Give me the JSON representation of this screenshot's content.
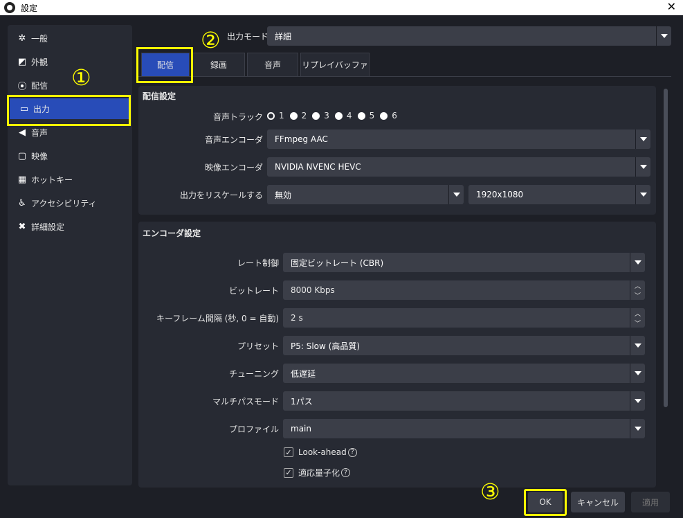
{
  "window": {
    "title": "設定",
    "close_glyph": "✕"
  },
  "sidebar": {
    "items": [
      {
        "label": "一般",
        "icon": "gear-icon",
        "glyph": "✲"
      },
      {
        "label": "外観",
        "icon": "appearance-icon",
        "glyph": "◩"
      },
      {
        "label": "配信",
        "icon": "broadcast-icon",
        "glyph": "⦿"
      },
      {
        "label": "出力",
        "icon": "output-icon",
        "glyph": "▭"
      },
      {
        "label": "音声",
        "icon": "speaker-icon",
        "glyph": "◀"
      },
      {
        "label": "映像",
        "icon": "monitor-icon",
        "glyph": "▢"
      },
      {
        "label": "ホットキー",
        "icon": "keyboard-icon",
        "glyph": "▦"
      },
      {
        "label": "アクセシビリティ",
        "icon": "accessibility-icon",
        "glyph": "♿"
      },
      {
        "label": "詳細設定",
        "icon": "tools-icon",
        "glyph": "✖"
      }
    ],
    "active_index": 3
  },
  "output_mode": {
    "label": "出力モード",
    "value": "詳細"
  },
  "tabs": [
    "配信",
    "録画",
    "音声",
    "リプレイバッファ"
  ],
  "active_tab": 0,
  "streaming_group": {
    "title": "配信設定",
    "audio_track_label": "音声トラック",
    "audio_tracks": [
      "1",
      "2",
      "3",
      "4",
      "5",
      "6"
    ],
    "audio_track_selected": 0,
    "audio_encoder_label": "音声エンコーダ",
    "audio_encoder": "FFmpeg AAC",
    "video_encoder_label": "映像エンコーダ",
    "video_encoder": "NVIDIA NVENC HEVC",
    "rescale_label": "出力をリスケールする",
    "rescale": "無効",
    "rescale_resolution": "1920x1080"
  },
  "encoder_group": {
    "title": "エンコーダ設定",
    "rate_control_label": "レート制御",
    "rate_control": "固定ビットレート (CBR)",
    "bitrate_label": "ビットレート",
    "bitrate": "8000 Kbps",
    "keyframe_label": "キーフレーム間隔 (秒, 0 = 自動)",
    "keyframe": "2 s",
    "preset_label": "プリセット",
    "preset": "P5: Slow (高品質)",
    "tuning_label": "チューニング",
    "tuning": "低遅延",
    "multipass_label": "マルチパスモード",
    "multipass": "1パス",
    "profile_label": "プロファイル",
    "profile": "main",
    "lookahead_label": "Look-ahead",
    "lookahead_checked": true,
    "aq_label": "適応量子化",
    "aq_checked": true,
    "help_glyph": "?",
    "check_glyph": "✓"
  },
  "buttons": {
    "ok": "OK",
    "cancel": "キャンセル",
    "apply": "適用"
  },
  "annotations": {
    "one": "①",
    "two": "②",
    "three": "③"
  },
  "colors": {
    "accent": "#284cb8",
    "highlight": "#ffff00",
    "panel": "#272a33",
    "background": "#1d1f26"
  }
}
